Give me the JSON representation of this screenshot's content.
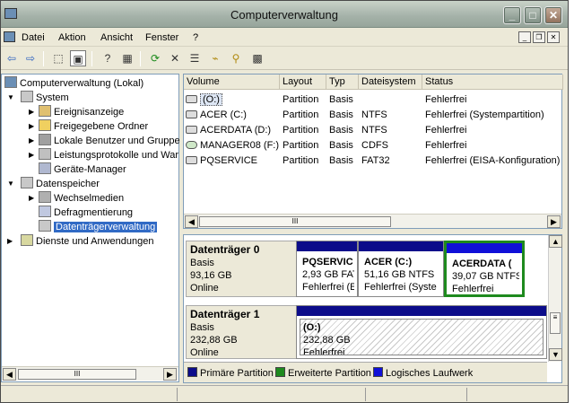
{
  "window": {
    "title": "Computerverwaltung"
  },
  "menu": [
    "Datei",
    "Aktion",
    "Ansicht",
    "Fenster",
    "?"
  ],
  "toolbar": {
    "back": "⇦",
    "forward": "⇨",
    "up": "⬚",
    "tree": "▣",
    "help1": "?",
    "list": "▦",
    "refresh": "⟳",
    "delete": "✕",
    "props": "☰",
    "open": "⌁",
    "find": "⚲",
    "more": "▩"
  },
  "tree": {
    "root": "Computerverwaltung (Lokal)",
    "system": "System",
    "ereignis": "Ereignisanzeige",
    "freigabe": "Freigegebene Ordner",
    "benutzer": "Lokale Benutzer und Gruppe",
    "leistung": "Leistungsprotokolle und War",
    "geraete": "Geräte-Manager",
    "daten": "Datenspeicher",
    "wechsel": "Wechselmedien",
    "defrag": "Defragmentierung",
    "dtv": "Datenträgerverwaltung",
    "dienste": "Dienste und Anwendungen"
  },
  "volumes": {
    "headers": [
      "Volume",
      "Layout",
      "Typ",
      "Dateisystem",
      "Status"
    ],
    "rows": [
      [
        "(O:)",
        "Partition",
        "Basis",
        "",
        "Fehlerfrei"
      ],
      [
        "ACER (C:)",
        "Partition",
        "Basis",
        "NTFS",
        "Fehlerfrei (Systempartition)"
      ],
      [
        "ACERDATA (D:)",
        "Partition",
        "Basis",
        "NTFS",
        "Fehlerfrei"
      ],
      [
        "MANAGER08 (F:)",
        "Partition",
        "Basis",
        "CDFS",
        "Fehlerfrei"
      ],
      [
        "PQSERVICE",
        "Partition",
        "Basis",
        "FAT32",
        "Fehlerfrei (EISA-Konfiguration)"
      ]
    ]
  },
  "disk0": {
    "name": "Datenträger 0",
    "type": "Basis",
    "size": "93,16 GB",
    "state": "Online",
    "parts": [
      {
        "name": "PQSERVIC",
        "size": "2,93 GB FAT",
        "status": "Fehlerfrei (E"
      },
      {
        "name": "ACER  (C:)",
        "size": "51,16 GB NTFS",
        "status": "Fehlerfrei (Syste"
      },
      {
        "name": "ACERDATA  (",
        "size": "39,07 GB NTFS",
        "status": "Fehlerfrei"
      }
    ]
  },
  "disk1": {
    "name": "Datenträger 1",
    "type": "Basis",
    "size": "232,88 GB",
    "state": "Online",
    "parts": [
      {
        "name": "(O:)",
        "size": "232,88 GB",
        "status": "Fehlerfrei"
      }
    ]
  },
  "legend": [
    "Primäre Partition",
    "Erweiterte Partition",
    "Logisches Laufwerk"
  ],
  "colors": {
    "primary": "#0c0c8a",
    "extended": "#1e8a1e",
    "logical": "#1010d8",
    "selection": "#316ac5"
  },
  "scroll": {
    "thumb": "III"
  }
}
